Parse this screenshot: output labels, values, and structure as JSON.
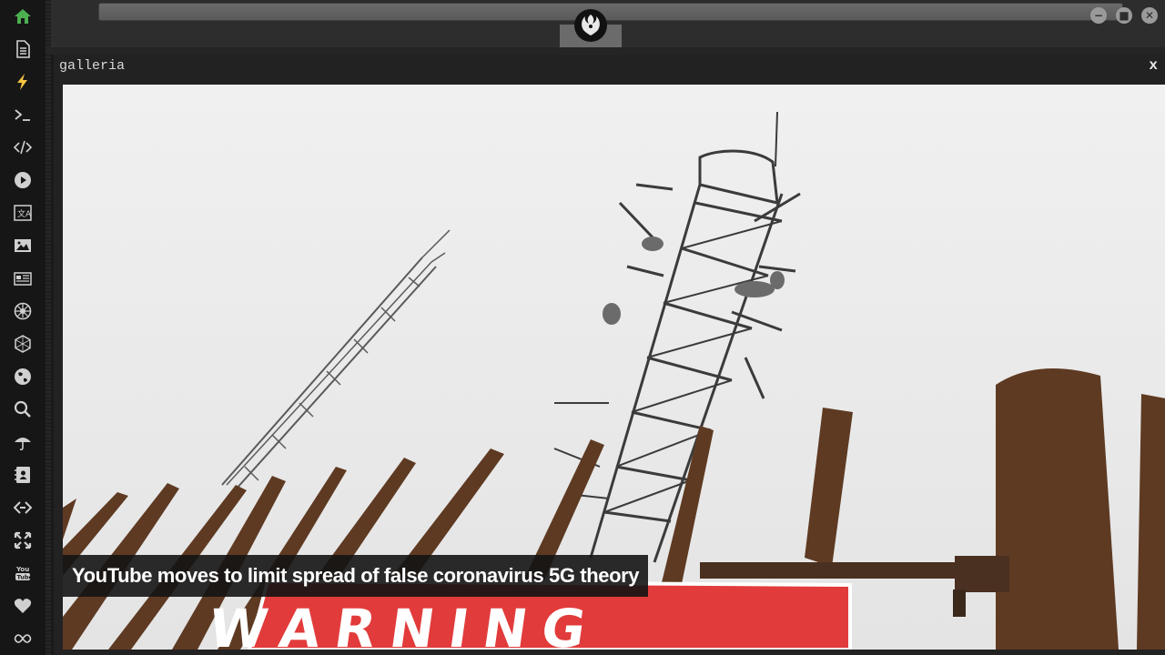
{
  "window": {
    "title": "galleria",
    "close_label": "x"
  },
  "gallery": {
    "caption": "YouTube moves to limit spread of false coronavirus 5G theory",
    "sign_text": "WARNING"
  },
  "sidebar": {
    "items": [
      {
        "icon": "home-icon",
        "active": true
      },
      {
        "icon": "document-icon"
      },
      {
        "icon": "lightning-icon"
      },
      {
        "icon": "terminal-icon"
      },
      {
        "icon": "code-icon"
      },
      {
        "icon": "play-icon"
      },
      {
        "icon": "translate-icon"
      },
      {
        "icon": "image-icon"
      },
      {
        "icon": "newspaper-icon"
      },
      {
        "icon": "galactic-empire-icon"
      },
      {
        "icon": "hexagon-icon"
      },
      {
        "icon": "globe-icon"
      },
      {
        "icon": "search-icon"
      },
      {
        "icon": "umbrella-icon"
      },
      {
        "icon": "contact-card-icon"
      },
      {
        "icon": "code-fork-icon"
      },
      {
        "icon": "expand-icon"
      },
      {
        "icon": "youtube-icon"
      },
      {
        "icon": "heart-icon"
      },
      {
        "icon": "infinity-icon"
      }
    ]
  },
  "colors": {
    "sidebar_bg": "#161616",
    "active_icon": "#4caf50",
    "icon": "#d0d0d0",
    "accent_lightning": "#f5c542",
    "sign_red": "#e23b3b"
  }
}
